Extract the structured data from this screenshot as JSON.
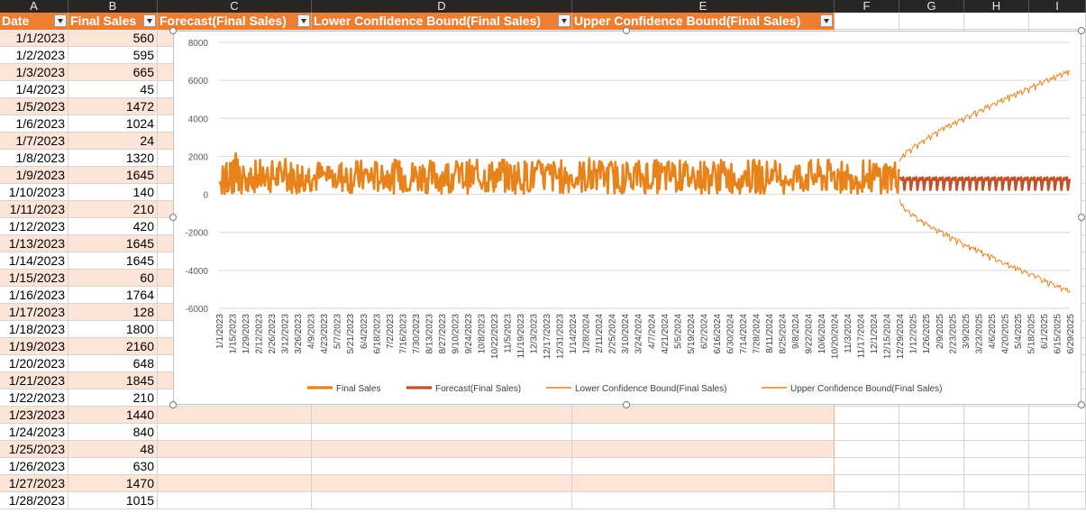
{
  "columns": [
    "A",
    "B",
    "C",
    "D",
    "E",
    "F",
    "G",
    "H",
    "I"
  ],
  "table": {
    "headers": [
      "Date",
      "Final Sales",
      "Forecast(Final Sales)",
      "Lower Confidence Bound(Final Sales)",
      "Upper Confidence Bound(Final Sales)"
    ],
    "rows": [
      [
        "1/1/2023",
        "560"
      ],
      [
        "1/2/2023",
        "595"
      ],
      [
        "1/3/2023",
        "665"
      ],
      [
        "1/4/2023",
        "45"
      ],
      [
        "1/5/2023",
        "1472"
      ],
      [
        "1/6/2023",
        "1024"
      ],
      [
        "1/7/2023",
        "24"
      ],
      [
        "1/8/2023",
        "1320"
      ],
      [
        "1/9/2023",
        "1645"
      ],
      [
        "1/10/2023",
        "140"
      ],
      [
        "1/11/2023",
        "210"
      ],
      [
        "1/12/2023",
        "420"
      ],
      [
        "1/13/2023",
        "1645"
      ],
      [
        "1/14/2023",
        "1645"
      ],
      [
        "1/15/2023",
        "60"
      ],
      [
        "1/16/2023",
        "1764"
      ],
      [
        "1/17/2023",
        "128"
      ],
      [
        "1/18/2023",
        "1800"
      ],
      [
        "1/19/2023",
        "2160"
      ],
      [
        "1/20/2023",
        "648"
      ],
      [
        "1/21/2023",
        "1845"
      ],
      [
        "1/22/2023",
        "210"
      ],
      [
        "1/23/2023",
        "1440"
      ],
      [
        "1/24/2023",
        "840"
      ],
      [
        "1/25/2023",
        "48"
      ],
      [
        "1/26/2023",
        "630"
      ],
      [
        "1/27/2023",
        "1470"
      ],
      [
        "1/28/2023",
        "1015"
      ]
    ]
  },
  "colors": {
    "header": "#ed7d31",
    "band": "#fce4d6",
    "sales": "#e8821a",
    "forecast": "#c0532a",
    "bounds": "#e8821a"
  },
  "chart_data": {
    "type": "line",
    "ylim": [
      -6000,
      8000
    ],
    "y_ticks": [
      "8000",
      "6000",
      "4000",
      "2000",
      "0",
      "-2000",
      "-4000",
      "-6000"
    ],
    "x_tick_labels": [
      "1/1/2023",
      "1/15/2023",
      "1/29/2023",
      "2/12/2023",
      "2/26/2023",
      "3/12/2023",
      "3/26/2023",
      "4/9/2023",
      "4/23/2023",
      "5/7/2023",
      "5/21/2023",
      "6/4/2023",
      "6/18/2023",
      "7/2/2023",
      "7/16/2023",
      "7/30/2023",
      "8/13/2023",
      "8/27/2023",
      "9/10/2023",
      "9/24/2023",
      "10/8/2023",
      "10/22/2023",
      "11/5/2023",
      "11/19/2023",
      "12/3/2023",
      "12/17/2023",
      "12/31/2023",
      "1/14/2024",
      "1/28/2024",
      "2/11/2024",
      "2/25/2024",
      "3/10/2024",
      "3/24/2024",
      "4/7/2024",
      "4/21/2024",
      "5/5/2024",
      "5/19/2024",
      "6/2/2024",
      "6/16/2024",
      "6/30/2024",
      "7/14/2024",
      "7/28/2024",
      "8/11/2024",
      "8/25/2024",
      "9/8/2024",
      "9/22/2024",
      "10/6/2024",
      "10/20/2024",
      "11/3/2024",
      "11/17/2024",
      "12/1/2024",
      "12/15/2024",
      "12/29/2024",
      "1/12/2025",
      "1/26/2025",
      "2/9/2025",
      "2/23/2025",
      "3/9/2025",
      "3/23/2025",
      "4/6/2025",
      "4/20/2025",
      "5/4/2025",
      "5/18/2025",
      "6/1/2025",
      "6/15/2025",
      "6/29/2025"
    ],
    "x_range": [
      "1/1/2023",
      "6/29/2025"
    ],
    "forecast_start": "12/29/2024",
    "series": [
      {
        "name": "Final Sales",
        "x_range": [
          "1/1/2023",
          "12/29/2024"
        ],
        "min": 24,
        "max": 2160,
        "values_start": [
          560,
          595,
          665,
          45,
          1472,
          1024,
          24,
          1320,
          1645,
          140,
          210,
          420,
          1645,
          1645,
          60,
          1764,
          128,
          1800,
          2160,
          648,
          1845,
          210,
          1440,
          840,
          48,
          630,
          1470,
          1015
        ]
      },
      {
        "name": "Forecast(Final Sales)",
        "x_range": [
          "12/29/2024",
          "6/29/2025"
        ],
        "min": 250,
        "max": 900
      },
      {
        "name": "Lower Confidence Bound(Final Sales)",
        "x_range": [
          "12/29/2024",
          "6/29/2025"
        ],
        "start": -300,
        "end": -5100
      },
      {
        "name": "Upper Confidence Bound(Final Sales)",
        "x_range": [
          "12/29/2024",
          "6/29/2025"
        ],
        "start": 1650,
        "end": 6500
      }
    ],
    "grid": true,
    "legend_position": "bottom"
  }
}
